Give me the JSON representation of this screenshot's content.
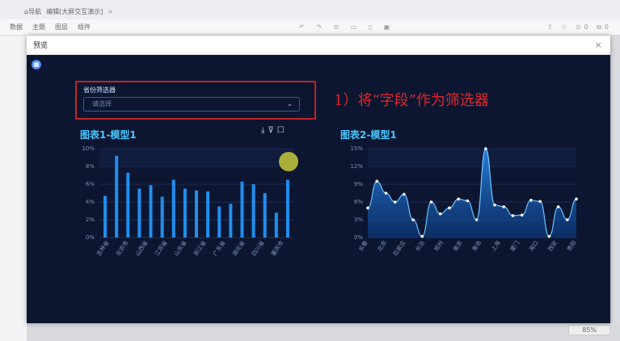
{
  "browser": {
    "home_label": "导航",
    "tab_label": "编辑[大屏交互演示]"
  },
  "toolbar": {
    "tabs": [
      "数据",
      "主题",
      "图层"
    ],
    "component_label": "组件",
    "right_counts": [
      "0",
      "0"
    ]
  },
  "modal": {
    "title": "预览"
  },
  "filter": {
    "label": "省份筛选器",
    "placeholder": "请选择"
  },
  "annotation": "1）将“字段”作为筛选器",
  "zoom": {
    "value": "85%"
  },
  "colors": {
    "canvas_bg": "#0c1631",
    "title": "#49c7ff",
    "bar": "#1f8ff0",
    "annotation": "#e0262b"
  },
  "chart_data": [
    {
      "type": "bar",
      "title": "图表1-模型1",
      "categories": [
        "吉林省",
        "北京市",
        "山西省",
        "江苏省",
        "山东省",
        "浙江省",
        "广东省",
        "湖北省",
        "四川省",
        "重庆市"
      ],
      "bar_labels_shown": true,
      "values": [
        4.7,
        9.2,
        7.3,
        5.5,
        5.9,
        4.6,
        6.5,
        5.5,
        5.3,
        5.2,
        3.5,
        3.8,
        6.3,
        6.0,
        5.0,
        2.8,
        6.5
      ],
      "ylim": [
        0,
        10
      ],
      "yticks": [
        "10%",
        "8%",
        "6%",
        "4%",
        "2%",
        "0%"
      ]
    },
    {
      "type": "area",
      "title": "图表2-模型1",
      "categories": [
        "长春",
        "北京",
        "石家庄",
        "长治",
        "郑州",
        "南京",
        "青岛",
        "上海",
        "厦门",
        "海口",
        "西安",
        "贵阳"
      ],
      "values": [
        5,
        9.5,
        7.5,
        6,
        7.3,
        3,
        0.2,
        6,
        4,
        5,
        6.5,
        6.2,
        3,
        15,
        5.5,
        5.2,
        3.7,
        3.8,
        6.3,
        6.1,
        0.2,
        5.2,
        3,
        6.5
      ],
      "ylim": [
        0,
        15
      ],
      "yticks": [
        "15%",
        "12%",
        "9%",
        "6%",
        "3%",
        "0%"
      ]
    }
  ]
}
